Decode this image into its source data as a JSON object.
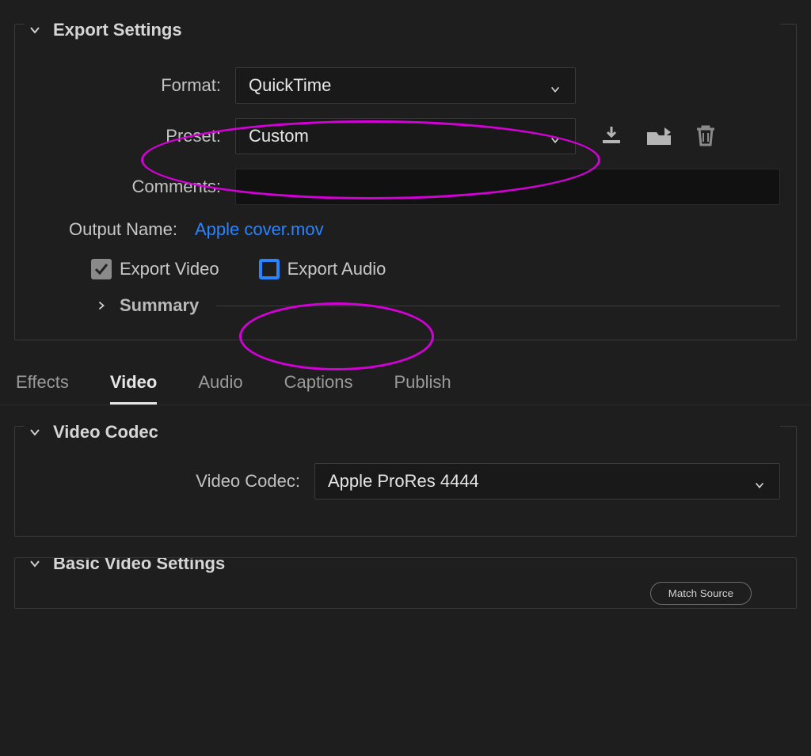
{
  "export_settings": {
    "title": "Export Settings",
    "format_label": "Format:",
    "format_value": "QuickTime",
    "preset_label": "Preset:",
    "preset_value": "Custom",
    "comments_label": "Comments:",
    "output_name_label": "Output Name:",
    "output_name_value": "Apple cover.mov",
    "export_video_label": "Export Video",
    "export_audio_label": "Export Audio",
    "summary_label": "Summary"
  },
  "icons": {
    "save_preset": "import-preset-icon",
    "import_preset": "save-preset-icon",
    "delete_preset": "trash-icon"
  },
  "tabs": {
    "effects": "Effects",
    "video": "Video",
    "audio": "Audio",
    "captions": "Captions",
    "publish": "Publish",
    "active": "video"
  },
  "video_codec": {
    "title": "Video Codec",
    "label": "Video Codec:",
    "value": "Apple ProRes 4444"
  },
  "basic_video": {
    "title": "Basic Video Settings",
    "match_source_label": "Match Source"
  },
  "annotation_color": "#d400d8"
}
